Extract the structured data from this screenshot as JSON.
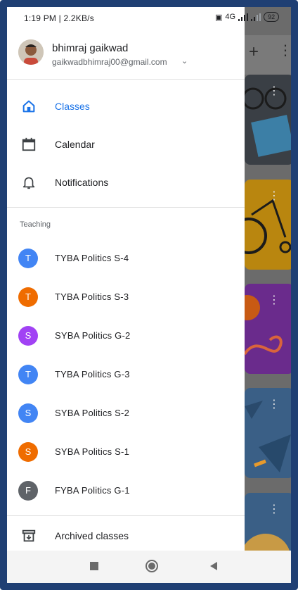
{
  "status": {
    "time_speed": "1:19 PM | 2.2KB/s",
    "network_label": "4G",
    "battery": "92"
  },
  "account": {
    "name": "bhimraj gaikwad",
    "email": "gaikwadbhimraj00@gmail.com"
  },
  "nav": {
    "classes": "Classes",
    "calendar": "Calendar",
    "notifications": "Notifications",
    "archived": "Archived classes"
  },
  "teaching": {
    "title": "Teaching",
    "classes": [
      {
        "initial": "T",
        "name": "TYBA Politics S-4",
        "color": "#4285f4"
      },
      {
        "initial": "T",
        "name": "TYBA Politics S-3",
        "color": "#ef6c00"
      },
      {
        "initial": "S",
        "name": "SYBA Politics G-2",
        "color": "#a142f4"
      },
      {
        "initial": "T",
        "name": "TYBA Politics G-3",
        "color": "#4285f4"
      },
      {
        "initial": "S",
        "name": "SYBA Politics S-2",
        "color": "#4285f4"
      },
      {
        "initial": "S",
        "name": "SYBA Politics S-1",
        "color": "#ef6c00"
      },
      {
        "initial": "F",
        "name": "FYBA Politics G-1",
        "color": "#5f6368"
      }
    ]
  },
  "colors": {
    "accent": "#1a73e8",
    "frame": "#1f3f73"
  },
  "icons": {
    "classes": "home-icon",
    "calendar": "calendar-icon",
    "notifications": "bell-icon",
    "archived": "archive-icon",
    "add": "plus-icon",
    "more": "more-vert-icon"
  }
}
